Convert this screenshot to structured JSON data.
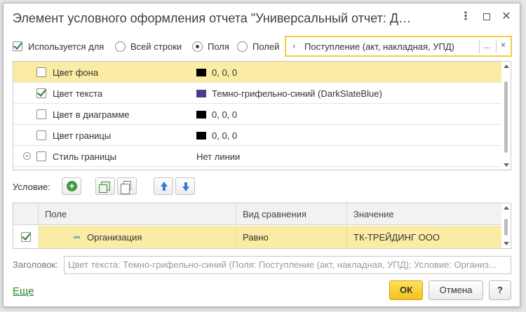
{
  "window": {
    "title": "Элемент условного оформления отчета \"Универсальный отчет: Д…",
    "menu_icon": "kebab-icon",
    "maximize_icon": "maximize-icon",
    "close_icon": "close-icon"
  },
  "usage": {
    "checkbox_label": "Используется для",
    "checked": true,
    "options": [
      {
        "label": "Всей строки",
        "selected": false
      },
      {
        "label": "Поля",
        "selected": true
      },
      {
        "label": "Полей",
        "selected": false
      }
    ],
    "field_value": "Поступление (акт, накладная, УПД)",
    "choose_label": "...",
    "clear_label": "×"
  },
  "properties": [
    {
      "name": "Цвет фона",
      "checked": false,
      "value": "0, 0, 0",
      "swatch": "#000000",
      "selected": true
    },
    {
      "name": "Цвет текста",
      "checked": true,
      "value": "Темно-грифельно-синий (DarkSlateBlue)",
      "swatch": "#483d8b",
      "selected": false
    },
    {
      "name": "Цвет в диаграмме",
      "checked": false,
      "value": "0, 0, 0",
      "swatch": "#000000",
      "selected": false
    },
    {
      "name": "Цвет границы",
      "checked": false,
      "value": "0, 0, 0",
      "swatch": "#000000",
      "selected": false
    },
    {
      "name": "Стиль границы",
      "checked": false,
      "value": "Нет линии",
      "swatch": "",
      "selected": false,
      "collapsible": true
    }
  ],
  "condition": {
    "label": "Условие:",
    "columns": [
      "Поле",
      "Вид сравнения",
      "Значение"
    ],
    "rows": [
      {
        "checked": true,
        "field": "Организация",
        "comparison": "Равно",
        "value": "ТК-ТРЕЙДИНГ ООО"
      }
    ]
  },
  "caption": {
    "label": "Заголовок:",
    "placeholder": "Цвет текста: Темно-грифельно-синий (Поля: Поступление (акт, накладная, УПД); Условие: Организ..."
  },
  "footer": {
    "more_label": "Еще",
    "ok_label": "ОК",
    "cancel_label": "Отмена",
    "help_label": "?"
  },
  "colors": {
    "accent": "#f3c21e",
    "selection": "#fbeca5",
    "link": "#2a8a2a"
  }
}
